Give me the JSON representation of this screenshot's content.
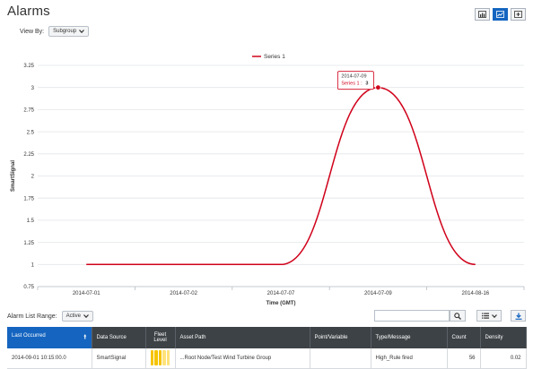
{
  "page": {
    "title": "Alarms"
  },
  "view_buttons": [
    {
      "icon": "bar-chart-icon",
      "active": false
    },
    {
      "icon": "line-chart-icon",
      "active": true
    },
    {
      "icon": "add-panel-icon",
      "active": false
    }
  ],
  "view_by": {
    "label": "View By:",
    "value": "Subgroup"
  },
  "chart_data": {
    "type": "line",
    "series": [
      {
        "name": "Series 1",
        "color": "#d0021b",
        "values": [
          1,
          1,
          1,
          3,
          1
        ]
      }
    ],
    "categories": [
      "2014-07-01",
      "2014-07-02",
      "2014-07-07",
      "2014-07-09",
      "2014-08-16"
    ],
    "xlabel": "Time (GMT)",
    "ylabel": "SmartSignal",
    "ylim": [
      0.75,
      3.25
    ],
    "yticks": [
      "0.75",
      "1",
      "1.25",
      "1.5",
      "1.75",
      "2",
      "2.25",
      "2.5",
      "2.75",
      "3",
      "3.25"
    ],
    "legend_position": "top-center",
    "grid": true,
    "tooltip": {
      "date": "2014-07-09",
      "series": "Series 1",
      "value": "3"
    }
  },
  "alarm_list": {
    "range_label": "Alarm List Range:",
    "range_value": "Active",
    "search_placeholder": ""
  },
  "table": {
    "columns": [
      "Last Occurred",
      "Data Source",
      "Fleet Level",
      "Asset Path",
      "Point/Variable",
      "Type/Message",
      "Count",
      "Density"
    ],
    "sorted_column": "Last Occurred",
    "rows": [
      {
        "last_occurred": "2014-09-01 10:15:00.0",
        "data_source": "SmartSignal",
        "fleet_level": 3,
        "asset_path": "...Root Node/Test Wind Turbine Group",
        "point_variable": "",
        "type_message": "High_Rule fired",
        "count": "56",
        "density": "0.02"
      }
    ]
  }
}
